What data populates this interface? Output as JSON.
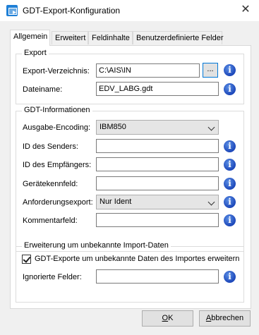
{
  "window": {
    "title": "GDT-Export-Konfiguration"
  },
  "tabs": [
    {
      "label": "Allgemein",
      "active": true
    },
    {
      "label": "Erweitert",
      "active": false
    },
    {
      "label": "Feldinhalte",
      "active": false
    },
    {
      "label": "Benutzerdefinierte Felder",
      "active": false
    }
  ],
  "export": {
    "legend": "Export",
    "dir_label": "Export-Verzeichnis:",
    "dir_value": "C:\\AIS\\IN",
    "browse_label": "...",
    "file_label": "Dateiname:",
    "file_value": "EDV_LABG.gdt"
  },
  "gdt": {
    "legend": "GDT-Informationen",
    "encoding_label": "Ausgabe-Encoding:",
    "encoding_value": "IBM850",
    "sender_label": "ID des Senders:",
    "sender_value": "",
    "receiver_label": "ID des Empfängers:",
    "receiver_value": "",
    "device_label": "Gerätekennfeld:",
    "device_value": "",
    "request_label": "Anforderungsexport:",
    "request_value": "Nur Ident",
    "comment_label": "Kommentarfeld:",
    "comment_value": ""
  },
  "import_ext": {
    "legend": "Erweiterung um unbekannte Import-Daten",
    "checkbox_label": "GDT-Exporte um unbekannte Daten des Importes erweitern",
    "checked": true,
    "ignored_label": "Ignorierte Felder:",
    "ignored_value": ""
  },
  "buttons": {
    "ok_accel": "O",
    "ok_rest": "K",
    "cancel_accel": "A",
    "cancel_rest": "bbrechen"
  },
  "icons": {
    "info": "i",
    "close": "✕"
  },
  "colors": {
    "info_blue": "#1c47b9",
    "focus_border": "#0078d7"
  }
}
